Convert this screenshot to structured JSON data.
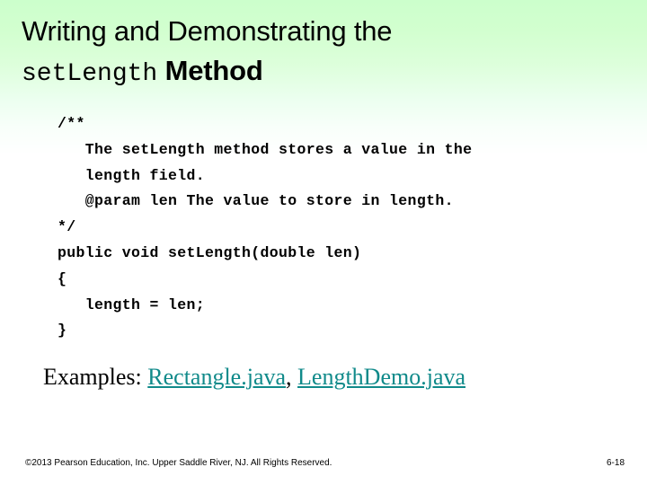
{
  "slide": {
    "background_top_color": "#ccffcc",
    "background_bottom_color": "#ffffff",
    "title": {
      "line1": "Writing and Demonstrating the",
      "line2_mono": "setLength",
      "line2_sans": " Method"
    },
    "code": {
      "lines": [
        "/**",
        "   The setLength method stores a value in the",
        "   length field.",
        "   @param len The value to store in length.",
        "*/",
        "public void setLength(double len)",
        "{",
        "   length = len;",
        "}"
      ]
    },
    "examples": {
      "label": "Examples: ",
      "separator": ", ",
      "links": [
        {
          "text": "Rectangle.java",
          "color": "#108a8a"
        },
        {
          "text": "LengthDemo.java",
          "color": "#108a8a"
        }
      ]
    },
    "footer": {
      "copyright": "©2013 Pearson Education, Inc. Upper Saddle River, NJ. All Rights Reserved.",
      "page_number": "6-18"
    }
  }
}
